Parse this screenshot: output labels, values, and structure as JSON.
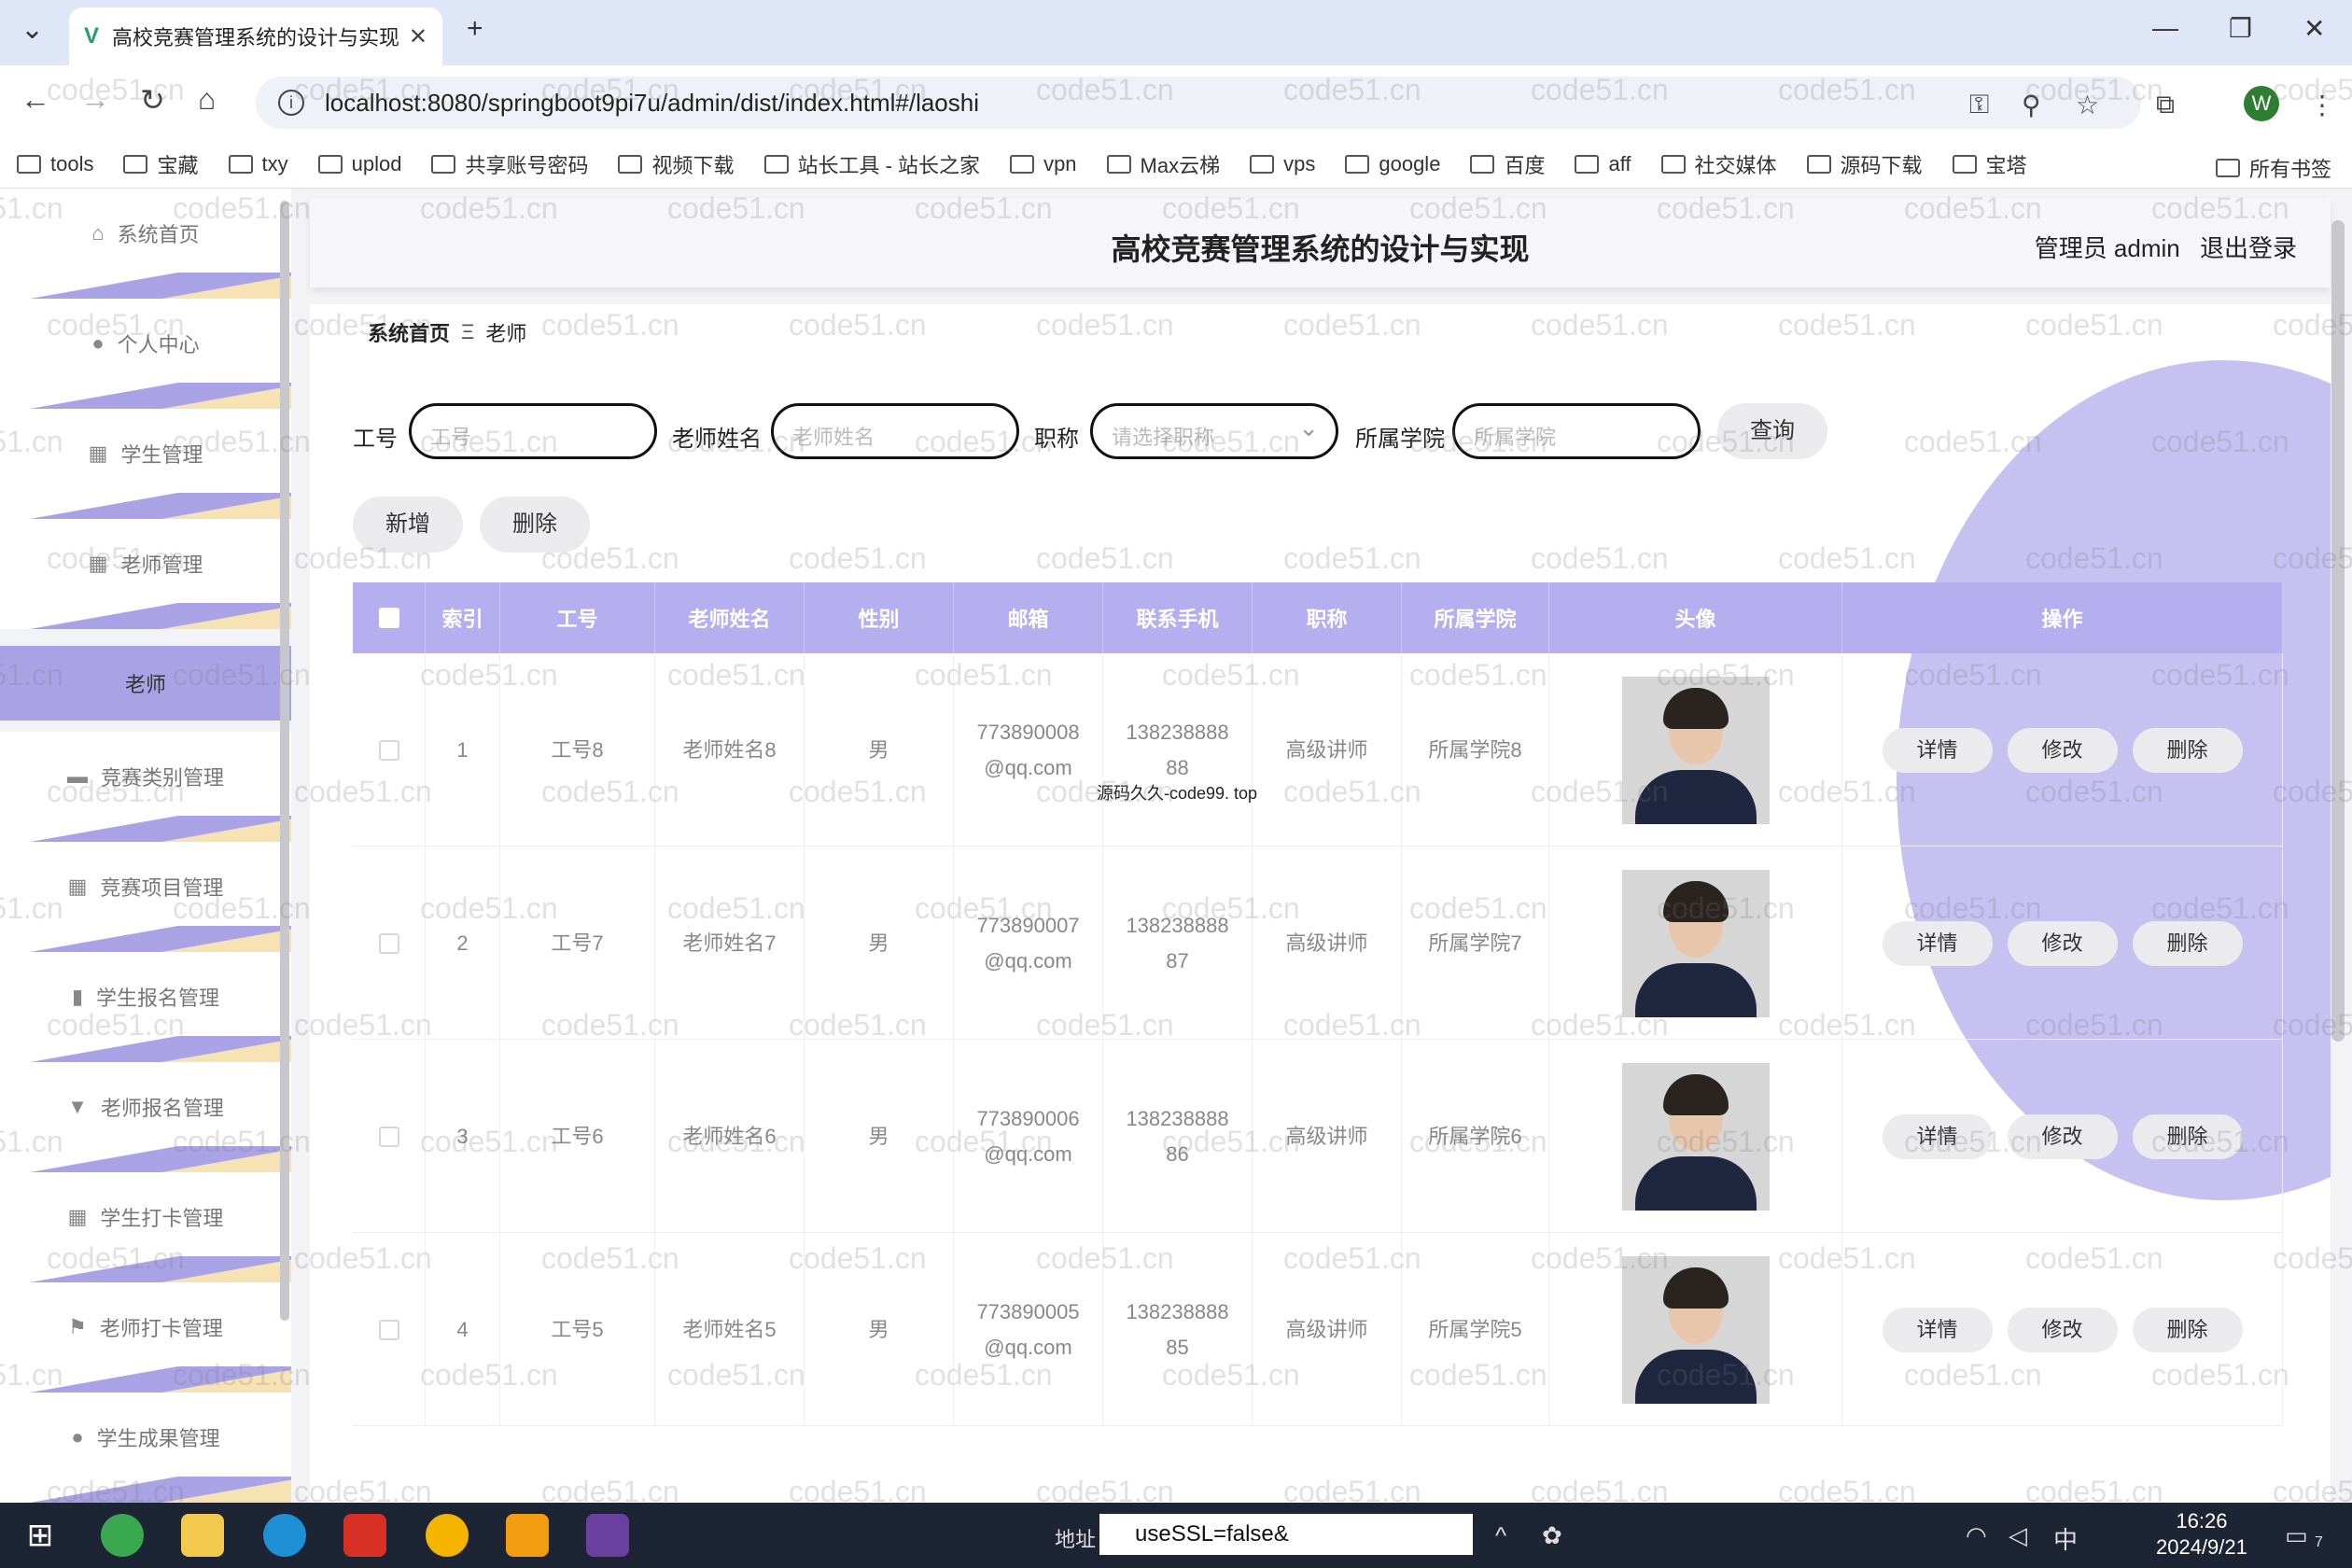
{
  "browser": {
    "tab_title": "高校竞赛管理系统的设计与实现",
    "tab_close": "✕",
    "new_tab": "+",
    "url": "localhost:8080/springboot9pi7u/admin/dist/index.html#/laoshi",
    "profile_initial": "W",
    "bookmarks": [
      "tools",
      "宝藏",
      "txy",
      "uplod",
      "共享账号密码",
      "视频下载",
      "站长工具 - 站长之家",
      "vpn",
      "Max云梯",
      "vps",
      "google",
      "百度",
      "aff",
      "社交媒体",
      "源码下载",
      "宝塔"
    ],
    "all_bookmarks": "所有书签"
  },
  "sidebar": {
    "items": [
      {
        "label": "系统首页",
        "icon": "home-icon",
        "glyph": "⌂"
      },
      {
        "label": "个人中心",
        "icon": "user-icon",
        "glyph": "●"
      },
      {
        "label": "学生管理",
        "icon": "grid-icon",
        "glyph": "▦"
      },
      {
        "label": "老师管理",
        "icon": "grid-icon",
        "glyph": "▦"
      },
      {
        "label": "竞赛类别管理",
        "icon": "briefcase-icon",
        "glyph": "▬"
      },
      {
        "label": "竞赛项目管理",
        "icon": "grid-icon",
        "glyph": "▦"
      },
      {
        "label": "学生报名管理",
        "icon": "chart-icon",
        "glyph": "▮"
      },
      {
        "label": "老师报名管理",
        "icon": "cup-icon",
        "glyph": "▼"
      },
      {
        "label": "学生打卡管理",
        "icon": "grid-icon",
        "glyph": "▦"
      },
      {
        "label": "老师打卡管理",
        "icon": "flag-icon",
        "glyph": "⚑"
      },
      {
        "label": "学生成果管理",
        "icon": "bulb-icon",
        "glyph": "●"
      }
    ],
    "active_sub": "老师"
  },
  "header": {
    "title": "高校竞赛管理系统的设计与实现",
    "user": "管理员 admin",
    "logout": "退出登录"
  },
  "breadcrumb": {
    "home": "系统首页",
    "sep": "Ξ",
    "current": "老师"
  },
  "search": {
    "gonghao_label": "工号",
    "gonghao_placeholder": "工号",
    "name_label": "老师姓名",
    "name_placeholder": "老师姓名",
    "title_label": "职称",
    "title_placeholder": "请选择职称",
    "college_label": "所属学院",
    "college_placeholder": "所属学院",
    "query": "查询"
  },
  "actions": {
    "add": "新增",
    "delete": "删除"
  },
  "table": {
    "columns": [
      "索引",
      "工号",
      "老师姓名",
      "性别",
      "邮箱",
      "联系手机",
      "职称",
      "所属学院",
      "头像",
      "操作"
    ],
    "row_actions": [
      "详情",
      "修改",
      "删除"
    ],
    "rows": [
      {
        "index": "1",
        "gonghao": "工号8",
        "name": "老师姓名8",
        "gender": "男",
        "email": "773890008@qq.com",
        "phone": "13823888888",
        "title": "高级讲师",
        "college": "所属学院8"
      },
      {
        "index": "2",
        "gonghao": "工号7",
        "name": "老师姓名7",
        "gender": "男",
        "email": "773890007@qq.com",
        "phone": "13823888887",
        "title": "高级讲师",
        "college": "所属学院7"
      },
      {
        "index": "3",
        "gonghao": "工号6",
        "name": "老师姓名6",
        "gender": "男",
        "email": "773890006@qq.com",
        "phone": "13823888886",
        "title": "高级讲师",
        "college": "所属学院6"
      },
      {
        "index": "4",
        "gonghao": "工号5",
        "name": "老师姓名5",
        "gender": "男",
        "email": "773890005@qq.com",
        "phone": "13823888885",
        "title": "高级讲师",
        "college": "所属学院5"
      }
    ]
  },
  "overlay_text": "源码久久-code99. top",
  "watermark": "code51.cn",
  "taskbar": {
    "addr_label": "地址",
    "addr_value": "useSSL=false&",
    "time": "16:26",
    "date": "2024/9/21",
    "ime": "中",
    "notif_count": "7"
  }
}
